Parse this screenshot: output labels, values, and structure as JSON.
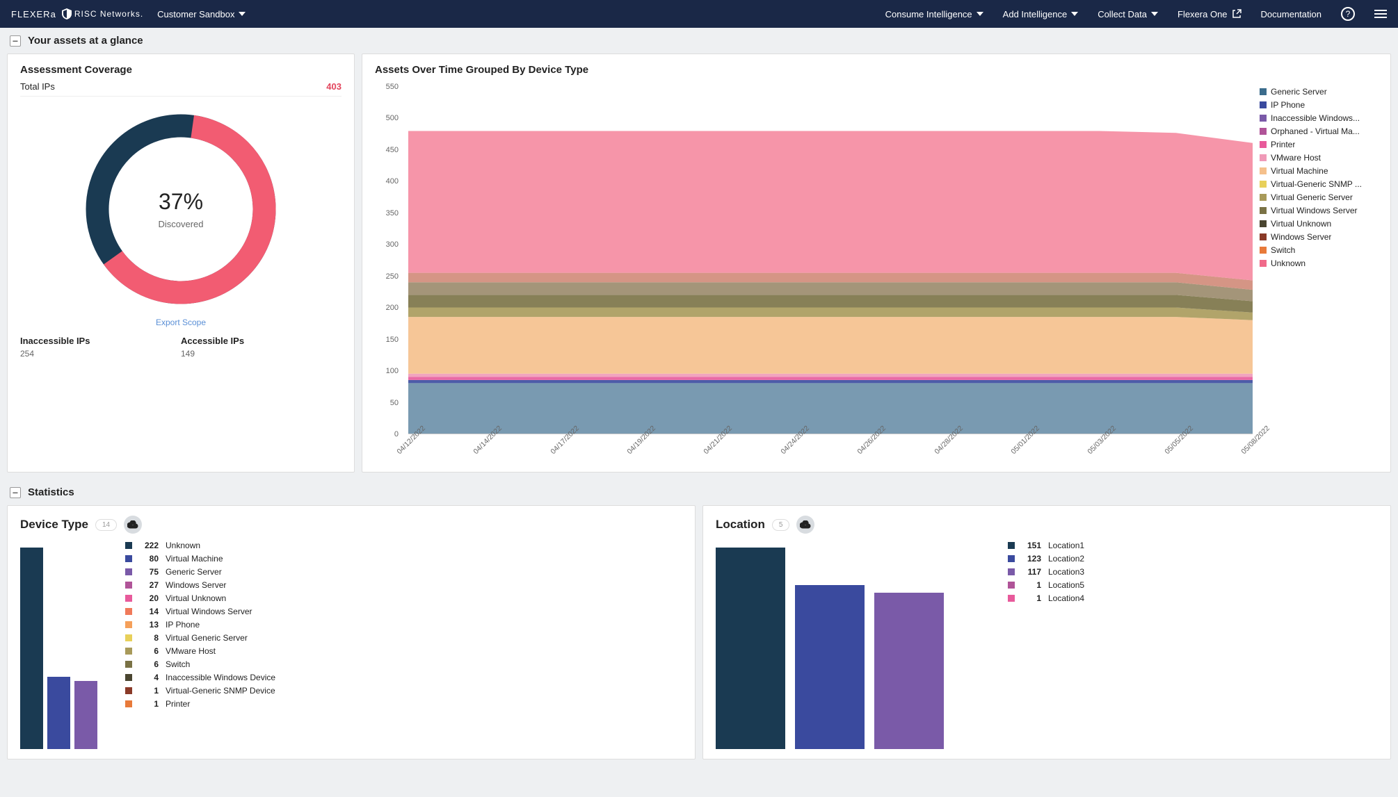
{
  "topbar": {
    "brand1": "FLEXERa",
    "brand2": "RISC Networks.",
    "sandbox": "Customer Sandbox",
    "menu": [
      {
        "label": "Consume Intelligence",
        "has_chevron": true
      },
      {
        "label": "Add Intelligence",
        "has_chevron": true
      },
      {
        "label": "Collect Data",
        "has_chevron": true
      },
      {
        "label": "Flexera One",
        "has_ext": true
      },
      {
        "label": "Documentation",
        "has_chevron": false
      }
    ]
  },
  "section1_title": "Your assets at a glance",
  "coverage": {
    "title": "Assessment Coverage",
    "total_label": "Total IPs",
    "total_value": "403",
    "percent": "37%",
    "discovered_label": "Discovered",
    "export_label": "Export Scope",
    "inaccessible_label": "Inaccessible IPs",
    "inaccessible_value": "254",
    "accessible_label": "Accessible IPs",
    "accessible_value": "149"
  },
  "aot": {
    "title": "Assets Over Time Grouped By Device Type",
    "legend": [
      {
        "label": "Generic Server",
        "color": "#3b6c8c"
      },
      {
        "label": "IP Phone",
        "color": "#3a4a9e"
      },
      {
        "label": "Inaccessible Windows...",
        "color": "#7a5aa8"
      },
      {
        "label": "Orphaned - Virtual Ma...",
        "color": "#b05498"
      },
      {
        "label": "Printer",
        "color": "#e85a9b"
      },
      {
        "label": "VMware Host",
        "color": "#f09ab8"
      },
      {
        "label": "Virtual Machine",
        "color": "#f5c08c"
      },
      {
        "label": "Virtual-Generic SNMP ...",
        "color": "#e8d05a"
      },
      {
        "label": "Virtual Generic Server",
        "color": "#a89a5a"
      },
      {
        "label": "Virtual Windows Server",
        "color": "#7a7245"
      },
      {
        "label": "Virtual Unknown",
        "color": "#4a4530"
      },
      {
        "label": "Windows Server",
        "color": "#8a3a28"
      },
      {
        "label": "Switch",
        "color": "#e87a3a"
      },
      {
        "label": "Unknown",
        "color": "#f06a8a"
      }
    ]
  },
  "chart_data": {
    "aot": {
      "type": "area",
      "title": "Assets Over Time Grouped By Device Type",
      "ylim": [
        0,
        550
      ],
      "yticks": [
        0,
        50,
        100,
        150,
        200,
        250,
        300,
        350,
        400,
        450,
        500,
        550
      ],
      "x": [
        "04/12/2022",
        "04/14/2022",
        "04/17/2022",
        "04/19/2022",
        "04/21/2022",
        "04/24/2022",
        "04/26/2022",
        "04/28/2022",
        "05/01/2022",
        "05/03/2022",
        "05/05/2022",
        "05/08/2022"
      ],
      "series": [
        {
          "name": "Generic Server",
          "color": "#6a8fa8",
          "values": [
            80,
            80,
            80,
            80,
            80,
            80,
            80,
            80,
            80,
            80,
            80,
            80
          ]
        },
        {
          "name": "IP Phone",
          "color": "#3a4a9e",
          "values": [
            5,
            5,
            5,
            5,
            5,
            5,
            5,
            5,
            5,
            5,
            5,
            5
          ]
        },
        {
          "name": "Printer",
          "color": "#e85a9b",
          "values": [
            5,
            5,
            5,
            5,
            5,
            5,
            5,
            5,
            5,
            5,
            5,
            5
          ]
        },
        {
          "name": "VMware Host",
          "color": "#f09ab8",
          "values": [
            5,
            5,
            5,
            5,
            5,
            5,
            5,
            5,
            5,
            5,
            5,
            5
          ]
        },
        {
          "name": "Virtual Machine",
          "color": "#f5c08c",
          "values": [
            90,
            90,
            90,
            90,
            90,
            90,
            90,
            90,
            90,
            90,
            90,
            85
          ]
        },
        {
          "name": "Virtual Generic Server",
          "color": "#a89a5a",
          "values": [
            15,
            15,
            15,
            15,
            15,
            15,
            15,
            15,
            15,
            15,
            15,
            12
          ]
        },
        {
          "name": "Virtual Windows Server",
          "color": "#7a7245",
          "values": [
            20,
            20,
            20,
            20,
            20,
            20,
            20,
            20,
            20,
            20,
            20,
            18
          ]
        },
        {
          "name": "Virtual Unknown",
          "color": "#9a8a6a",
          "values": [
            20,
            20,
            20,
            20,
            20,
            20,
            20,
            20,
            20,
            20,
            20,
            18
          ]
        },
        {
          "name": "Windows Server",
          "color": "#d08a78",
          "values": [
            15,
            15,
            15,
            15,
            15,
            15,
            15,
            15,
            15,
            15,
            15,
            15
          ]
        },
        {
          "name": "Switch",
          "color": "#e87a3a",
          "values": [
            0,
            0,
            0,
            0,
            0,
            0,
            0,
            0,
            0,
            0,
            0,
            0
          ]
        },
        {
          "name": "Unknown",
          "color": "#f58aa0",
          "values": [
            225,
            225,
            225,
            225,
            225,
            225,
            225,
            225,
            225,
            225,
            222,
            218
          ]
        }
      ]
    },
    "donut": {
      "type": "pie",
      "title": "Assessment Coverage",
      "series": [
        {
          "name": "Discovered",
          "value": 149,
          "color": "#f25c72"
        },
        {
          "name": "Not Discovered",
          "value": 254,
          "color": "#1a3a52"
        }
      ]
    },
    "device_type": {
      "type": "bar",
      "title": "Device Type",
      "series": [
        {
          "name": "Unknown",
          "value": 222,
          "color": "#1a3a52"
        },
        {
          "name": "Virtual Machine",
          "value": 80,
          "color": "#3a4a9e"
        },
        {
          "name": "Generic Server",
          "value": 75,
          "color": "#7a5aa8"
        },
        {
          "name": "Windows Server",
          "value": 27,
          "color": "#b05498"
        },
        {
          "name": "Virtual Unknown",
          "value": 20,
          "color": "#e85a9b"
        },
        {
          "name": "Virtual Windows Server",
          "value": 14,
          "color": "#f07a5a"
        },
        {
          "name": "IP Phone",
          "value": 13,
          "color": "#f5a05a"
        },
        {
          "name": "Virtual Generic Server",
          "value": 8,
          "color": "#e8d05a"
        },
        {
          "name": "VMware Host",
          "value": 6,
          "color": "#a89a5a"
        },
        {
          "name": "Switch",
          "value": 6,
          "color": "#7a7245"
        },
        {
          "name": "Inaccessible Windows Device",
          "value": 4,
          "color": "#4a4530"
        },
        {
          "name": "Virtual-Generic SNMP Device",
          "value": 1,
          "color": "#8a3a28"
        },
        {
          "name": "Printer",
          "value": 1,
          "color": "#e87a3a"
        }
      ]
    },
    "location": {
      "type": "bar",
      "title": "Location",
      "series": [
        {
          "name": "Location1",
          "value": 151,
          "color": "#1a3a52"
        },
        {
          "name": "Location2",
          "value": 123,
          "color": "#3a4a9e"
        },
        {
          "name": "Location3",
          "value": 117,
          "color": "#7a5aa8"
        },
        {
          "name": "Location5",
          "value": 1,
          "color": "#b05498"
        },
        {
          "name": "Location4",
          "value": 1,
          "color": "#e85a9b"
        }
      ]
    }
  },
  "section2_title": "Statistics",
  "device_type": {
    "title": "Device Type",
    "count": "14"
  },
  "location": {
    "title": "Location",
    "count": "5"
  }
}
